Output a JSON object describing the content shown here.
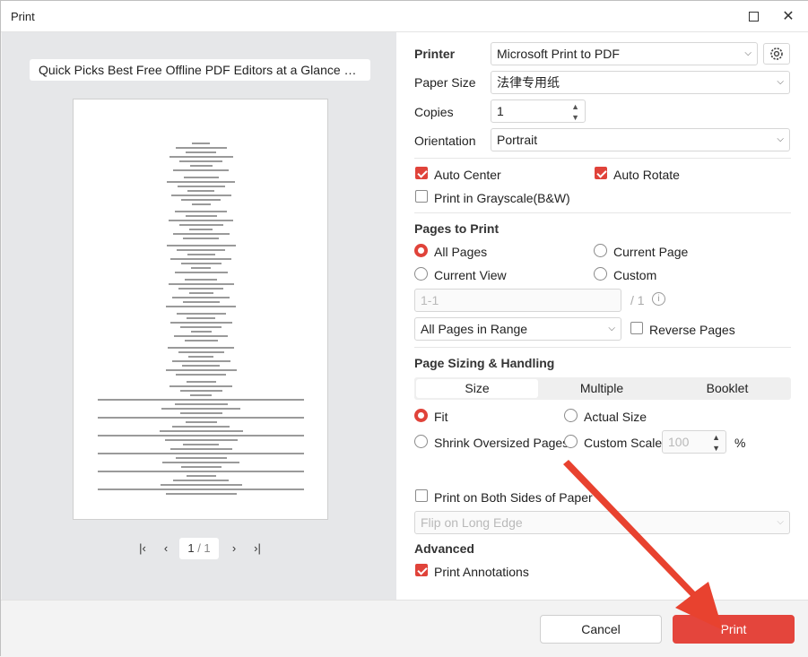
{
  "window": {
    "title": "Print"
  },
  "preview": {
    "doc_title": "Quick Picks Best Free Offline PDF Editors at a Glance Catego...",
    "page_current": "1",
    "page_total": "/ 1"
  },
  "printer": {
    "label": "Printer",
    "value": "Microsoft Print to PDF"
  },
  "paper_size": {
    "label": "Paper Size",
    "value": "法律专用纸"
  },
  "copies": {
    "label": "Copies",
    "value": "1"
  },
  "orientation": {
    "label": "Orientation",
    "value": "Portrait"
  },
  "options": {
    "auto_center": {
      "label": "Auto Center",
      "checked": true
    },
    "auto_rotate": {
      "label": "Auto Rotate",
      "checked": true
    },
    "grayscale": {
      "label": "Print in Grayscale(B&W)",
      "checked": false
    }
  },
  "pages_to_print": {
    "heading": "Pages to Print",
    "all_pages": "All Pages",
    "current_page": "Current Page",
    "current_view": "Current View",
    "custom": "Custom",
    "selected": "All Pages",
    "range_placeholder": "1-1",
    "range_total": "/ 1",
    "range_select": "All Pages in Range",
    "reverse_pages": "Reverse Pages"
  },
  "sizing": {
    "heading": "Page Sizing & Handling",
    "tabs": [
      "Size",
      "Multiple",
      "Booklet"
    ],
    "active_tab": "Size",
    "fit": "Fit",
    "actual_size": "Actual Size",
    "shrink": "Shrink Oversized Pages",
    "custom_scale": "Custom Scale",
    "scale_value": "100",
    "scale_unit": "%",
    "selected": "Fit"
  },
  "duplex": {
    "label": "Print on Both Sides of Paper",
    "flip_value": "Flip on Long Edge"
  },
  "advanced": {
    "heading": "Advanced",
    "print_annotations": "Print Annotations"
  },
  "buttons": {
    "cancel": "Cancel",
    "print": "Print"
  },
  "colors": {
    "accent": "#e0433a",
    "print_button": "#e4453c"
  }
}
